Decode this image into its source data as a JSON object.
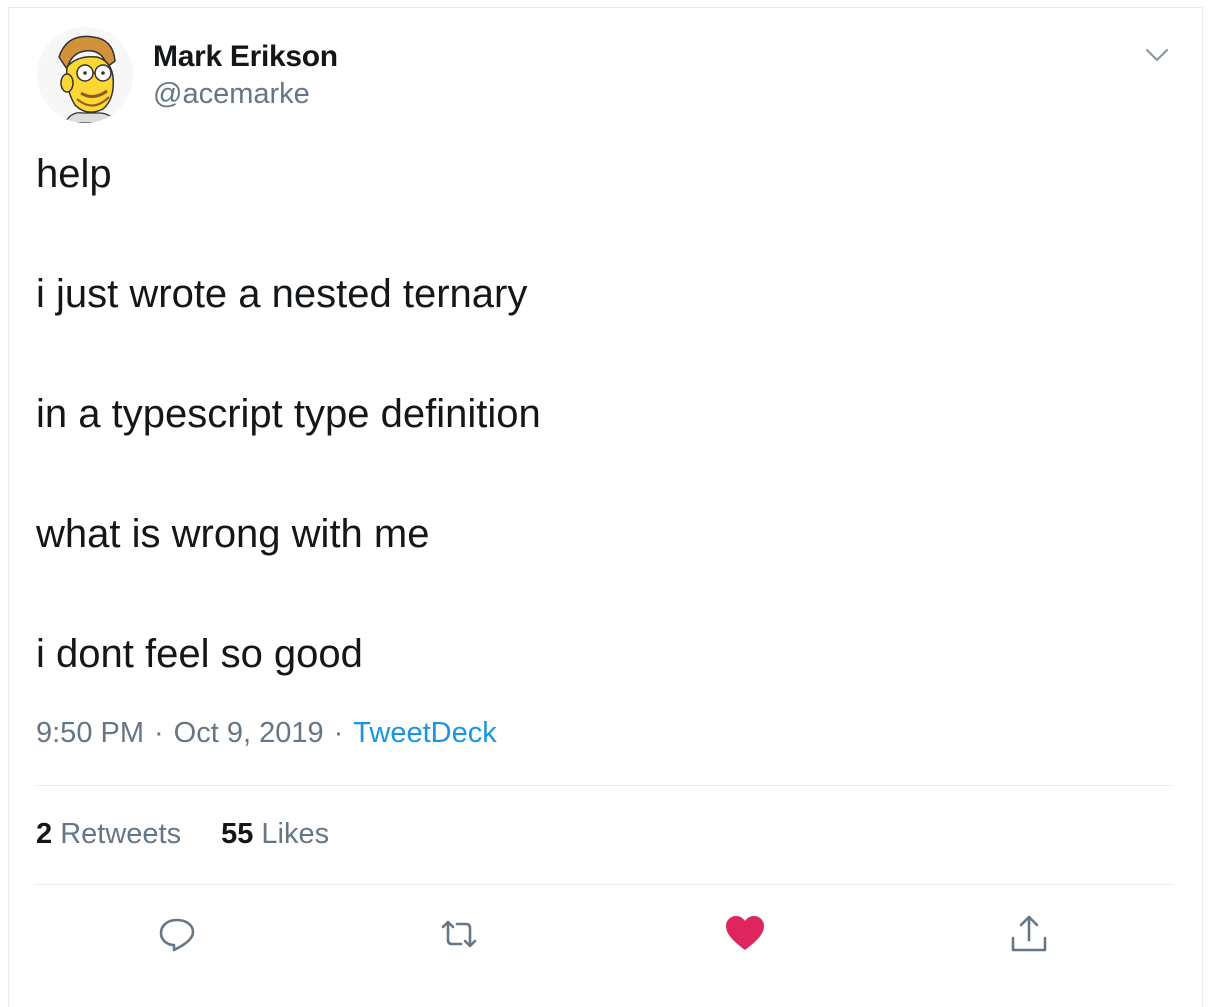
{
  "author": {
    "display_name": "Mark Erikson",
    "handle": "@acemarke",
    "avatar_icon": "cartoon-avatar-icon"
  },
  "tweet": {
    "lines": [
      "help",
      "i just wrote a nested ternary",
      "in a typescript type definition",
      "what is wrong with me",
      "i dont feel so good"
    ]
  },
  "meta": {
    "time": "9:50 PM",
    "separator": "·",
    "date": "Oct 9, 2019",
    "source": "TweetDeck"
  },
  "stats": {
    "retweets_count": "2",
    "retweets_label": "Retweets",
    "likes_count": "55",
    "likes_label": "Likes"
  },
  "actions": {
    "reply_icon": "reply-icon",
    "retweet_icon": "retweet-icon",
    "like_icon": "heart-icon",
    "share_icon": "share-icon",
    "like_color": "#e0245e",
    "icon_color": "#657786"
  },
  "colors": {
    "link": "#1b95e0",
    "secondary_text": "#657786",
    "primary_text": "#14171a",
    "border": "#e6ecf0"
  }
}
